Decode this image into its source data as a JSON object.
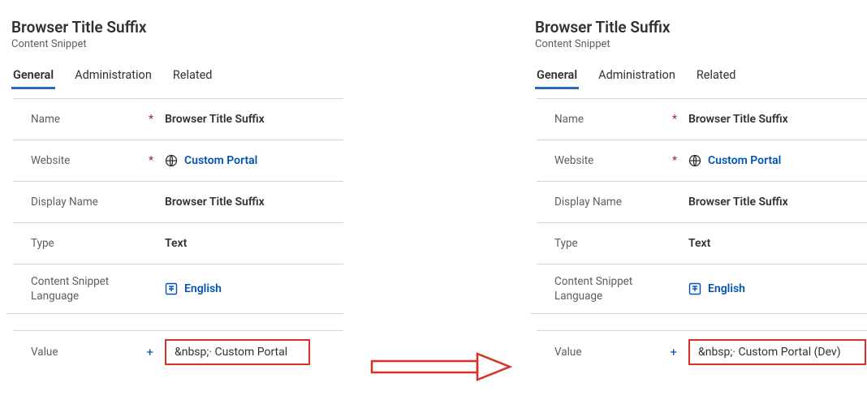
{
  "left": {
    "title": "Browser Title Suffix",
    "subtitle": "Content Snippet",
    "tabs": {
      "general": "General",
      "administration": "Administration",
      "related": "Related"
    },
    "fields": {
      "name_label": "Name",
      "name_value": "Browser Title Suffix",
      "website_label": "Website",
      "website_value": "Custom Portal",
      "display_label": "Display Name",
      "display_value": "Browser Title Suffix",
      "type_label": "Type",
      "type_value": "Text",
      "lang_label": "Content Snippet Language",
      "lang_value": "English",
      "value_label": "Value",
      "value_value": "&nbsp;· Custom Portal"
    }
  },
  "right": {
    "title": "Browser Title Suffix",
    "subtitle": "Content Snippet",
    "tabs": {
      "general": "General",
      "administration": "Administration",
      "related": "Related"
    },
    "fields": {
      "name_label": "Name",
      "name_value": "Browser Title Suffix",
      "website_label": "Website",
      "website_value": "Custom Portal",
      "display_label": "Display Name",
      "display_value": "Browser Title Suffix",
      "type_label": "Type",
      "type_value": "Text",
      "lang_label": "Content Snippet Language",
      "lang_value": "English",
      "value_label": "Value",
      "value_value": "&nbsp;· Custom Portal (Dev)"
    }
  },
  "marks": {
    "required": "*",
    "recommended": "+"
  }
}
